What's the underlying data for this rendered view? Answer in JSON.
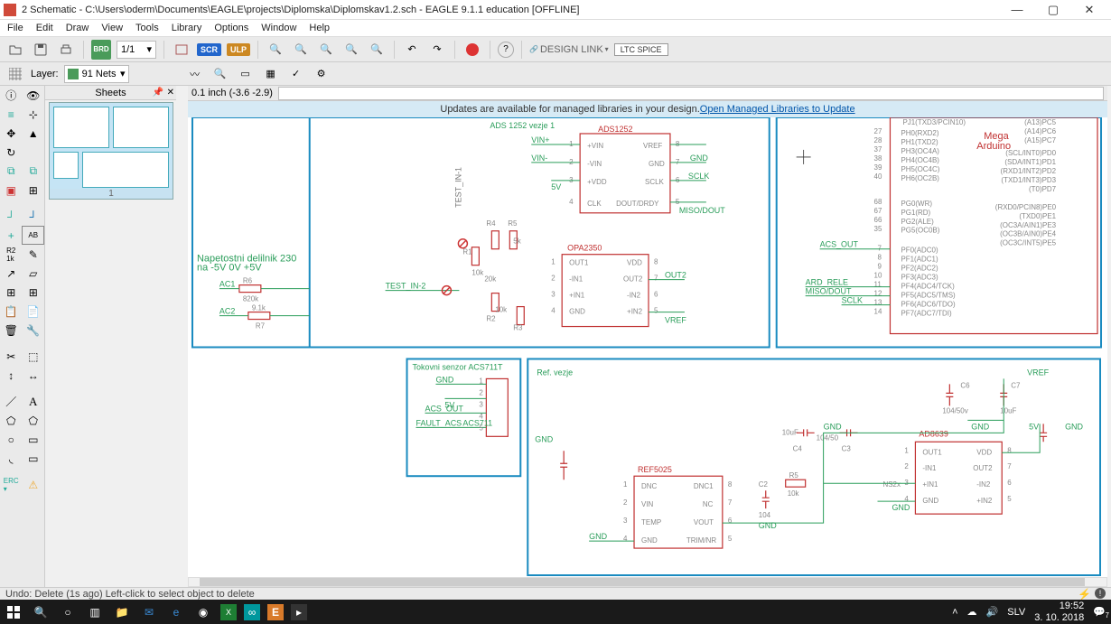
{
  "window": {
    "title": "2 Schematic - C:\\Users\\oderm\\Documents\\EAGLE\\projects\\Diplomska\\Diplomskav1.2.sch - EAGLE 9.1.1 education [OFFLINE]"
  },
  "menu": [
    "File",
    "Edit",
    "Draw",
    "View",
    "Tools",
    "Library",
    "Options",
    "Window",
    "Help"
  ],
  "toolbar": {
    "page_combo": "1/1",
    "badges": {
      "scr": "SCR",
      "ulp": "ULP"
    },
    "design_link": "DESIGN LINK",
    "ltspice": "LTC SPICE"
  },
  "layerbar": {
    "label": "Layer:",
    "value": "91 Nets"
  },
  "sheets": {
    "title": "Sheets",
    "page": "1"
  },
  "coords": {
    "grid": "0.1 inch (-3.6 -2.9)"
  },
  "notice": {
    "text": "Updates are available for managed libraries in your design. ",
    "link": "Open Managed Libraries to Update"
  },
  "status": {
    "text": "Undo: Delete (1s ago) Left-click to select object to delete"
  },
  "taskbar": {
    "lang": "SLV",
    "time": "19:52",
    "date": "3. 10. 2018",
    "notif_count": "7"
  },
  "schematic": {
    "frame1_title": "ADS 1252 vezje 1",
    "frame2_title": "Napetostni delilnik 230 na -5V 0V +5V",
    "frame3_title": "Tokovni senzor ACS711T",
    "frame4_title": "Ref. vezje",
    "arduino_title": "Mega Arduino",
    "ic_ads1252": "ADS1252",
    "ic_opa2350": "OPA2350",
    "ic_ref5025": "REF5025",
    "ic_ad8639": "AD8639",
    "nets": {
      "vin_plus": "VIN+",
      "vin_minus": "VIN-",
      "gnd": "GND",
      "sclk": "SCLK",
      "miso": "MISO/DOUT",
      "vref": "VREF",
      "out2": "OUT2",
      "acs_out": "ACS_OUT",
      "ard_rele": "ARD_RELE",
      "test_in1": "TEST_IN-1",
      "test_in2": "TEST_IN-2",
      "ac1": "AC1",
      "ac2": "AC2",
      "fault": "FAULT_ACS",
      "acs711": "ACS711",
      "5v": "5V"
    },
    "pins_ads": [
      "+VIN",
      "VREF",
      "-VIN",
      "GND",
      "+VDD",
      "SCLK",
      "CLK",
      "DOUT/DRDY"
    ],
    "pins_opa": [
      "OUT1",
      "VDD",
      "-IN1",
      "OUT2",
      "+IN1",
      "-IN2",
      "GND",
      "+IN2"
    ],
    "pins_ref": [
      "DNC",
      "DNC1",
      "VIN",
      "NC",
      "TEMP",
      "VOUT",
      "GND",
      "TRIM/NR"
    ],
    "pins_ad": [
      "OUT1",
      "VDD",
      "-IN1",
      "OUT2",
      "+IN1",
      "-IN2",
      "GND",
      "+IN2"
    ],
    "parts": {
      "r1": "R1",
      "r6": "R6",
      "r7": "R7",
      "r6_val": "820k",
      "r7_val": "9.1k",
      "r4": "R4",
      "r5": "R5",
      "r2": "R2",
      "r3": "R3",
      "r2_val": "10k",
      "r3_val": "10k",
      "c6": "C6",
      "c7": "C7",
      "c6_val": "104/50v",
      "c7_val": "10uF",
      "c3": "C3",
      "c4": "C4",
      "c3_val": "104/50",
      "c2": "C2",
      "c2_val": "104",
      "c8": "10uF",
      "ns2x": "NS2x",
      "r_10k": "10k",
      "r_20k": "20k",
      "r_5k": "5k"
    },
    "arduino_left_pins": [
      "27",
      "28",
      "37",
      "38",
      "39",
      "40",
      "68",
      "67",
      "66",
      "35",
      "7",
      "8",
      "9",
      "10",
      "11",
      "12",
      "13",
      "14"
    ],
    "arduino_left_labels": [
      "PH0(RXD2)",
      "PH1(TXD2)",
      "PH3(OC4A)",
      "PH4(OC4B)",
      "PH5(OC4C)",
      "PH6(OC2B)",
      "PG0(WR)",
      "PG1(RD)",
      "PG2(ALE)",
      "PG5(OC0B)",
      "PF0(ADC0)",
      "PF1(ADC1)",
      "PF2(ADC2)",
      "PF3(ADC3)",
      "PF4(ADC4/TCK)",
      "PF5(ADC5/TMS)",
      "PF6(ADC6/TDO)",
      "PF7(ADC7/TDI)"
    ],
    "arduino_right_labels": [
      "(A13)PC5",
      "(A14)PC6",
      "(A15)PC7",
      "(SCL/INT0)PD0",
      "(SDA/INT1)PD1",
      "(RXD1/INT2)PD2",
      "(TXD1/INT3)PD3",
      "(T0)PD7",
      "(RXD0/PCIN8)PE0",
      "(TXD0)PE1",
      "(OC3A/AIN1)PE3",
      "(OC3B/AIN0)PE4",
      "(OC3C/INT5)PE5"
    ],
    "arduino_top": "PJ1(TXD3/PCIN10)"
  }
}
